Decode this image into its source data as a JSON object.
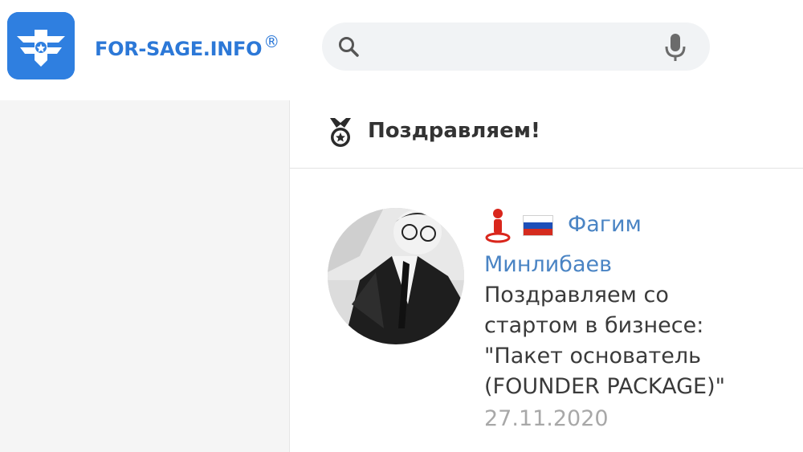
{
  "header": {
    "logo_name": "logo-mark",
    "site_name": "FOR-SAGE.INFO",
    "registered_mark": "®",
    "search": {
      "placeholder": "",
      "value": ""
    },
    "icons": [
      "search-icon",
      "mic-icon"
    ]
  },
  "section": {
    "title": "Поздравляем!",
    "icon": "medal-icon"
  },
  "card": {
    "avatar": "avatar",
    "name_first": "Фагим",
    "name_last": "Минлибаев",
    "message": "Поздравляем со\nстартом в бизнесе:\n\"Пакет основатель\n(FOUNDER PACKAGE)\"",
    "date": "27.11.2020",
    "flag": "flag-ru-icon",
    "location_icon": "user-location-icon"
  },
  "colors": {
    "brand_blue": "#2c78d7",
    "link_blue": "#4a84c4",
    "accent_red": "#d9261c",
    "panel_gray": "#f5f5f5"
  }
}
